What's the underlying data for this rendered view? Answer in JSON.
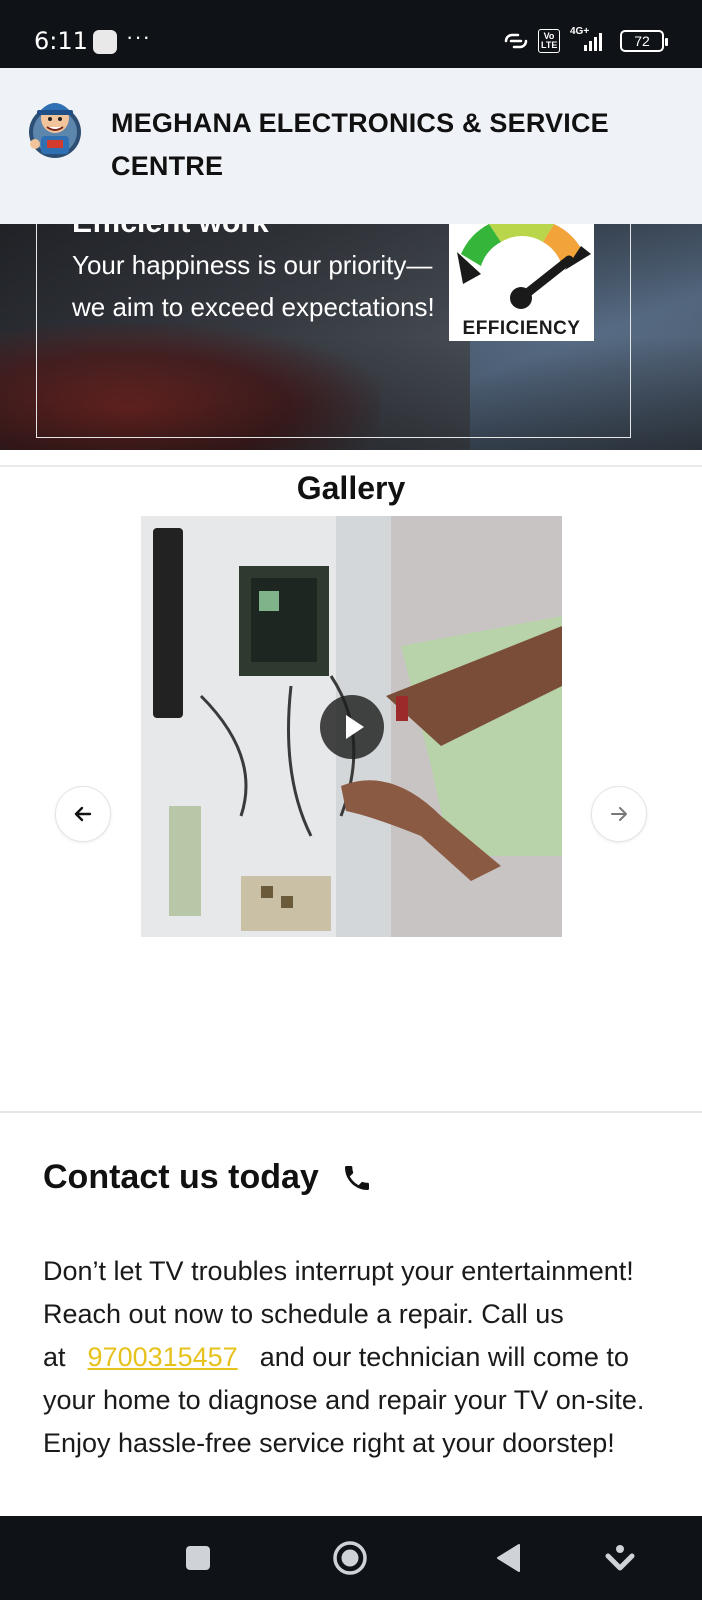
{
  "status_bar": {
    "time": "6:11",
    "more": "···",
    "network_type": "4G+",
    "volte": "Vo LTE",
    "battery": "72"
  },
  "header": {
    "title": "MEGHANA ELECTRONICS & SERVICE CENTRE"
  },
  "hero": {
    "heading": "Efficient work",
    "text": "Your happiness is our priority—we aim to exceed expectations!",
    "badge_label": "EFFICIENCY"
  },
  "gallery": {
    "title": "Gallery"
  },
  "contact": {
    "title": "Contact us today",
    "text_before": "Don’t let TV troubles interrupt your entertainment! Reach out now to schedule a repair. Call us at",
    "phone": "9700315457",
    "text_after": "and our technician will come to your home to diagnose and repair your TV on-site. Enjoy hassle-free service right at your doorstep!"
  },
  "colors": {
    "header_bg": "#eff2f6",
    "phone_link": "#e7c21d",
    "system_bars": "#0f1216"
  },
  "icons": {
    "contact": "phone-icon",
    "gallery_prev": "arrow-left-icon",
    "gallery_next": "arrow-right-icon",
    "video": "play-icon"
  }
}
